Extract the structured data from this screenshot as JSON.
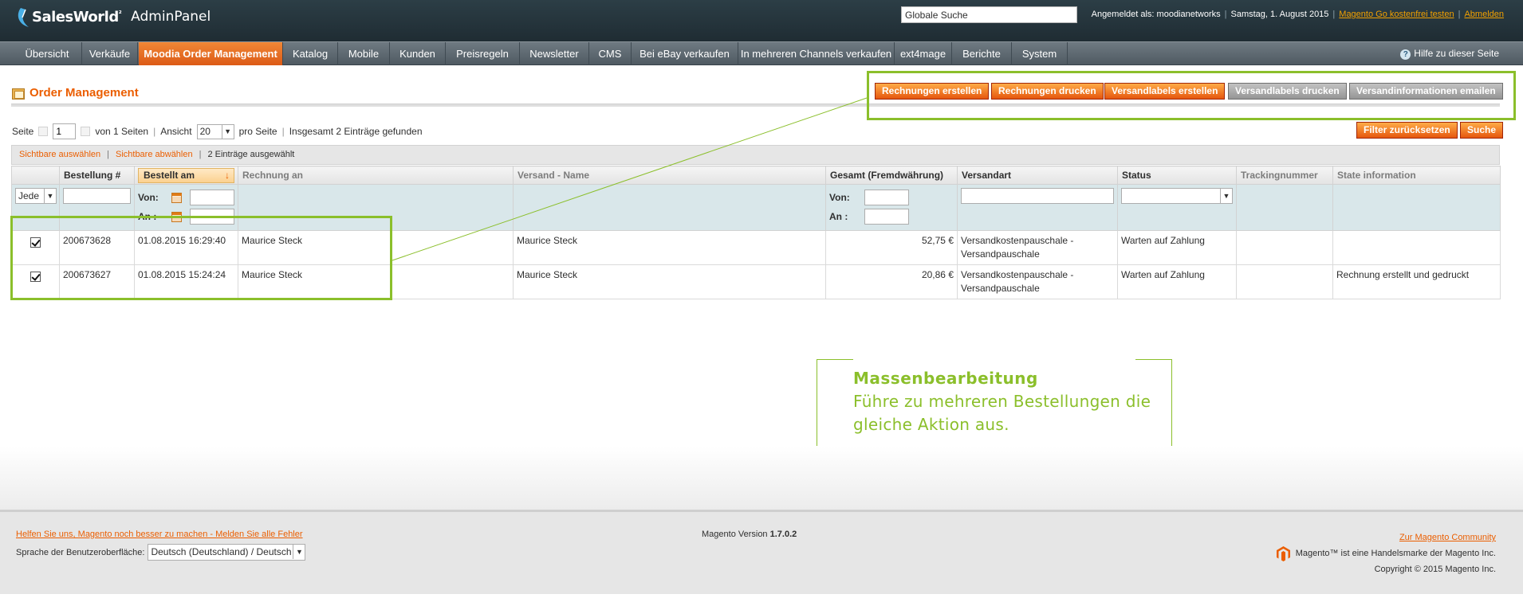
{
  "header": {
    "logo_text": "SalesWorld",
    "logo_sup": "²",
    "logo_sub": "AdminPanel",
    "search_value": "Globale Suche",
    "logged_in": "Angemeldet als: moodianetworks",
    "date": "Samstag, 1. August 2015",
    "try_link": "Magento Go kostenfrei testen",
    "logout_link": "Abmelden"
  },
  "nav": {
    "items": [
      "Übersicht",
      "Verkäufe",
      "Moodia Order Management",
      "Katalog",
      "Mobile",
      "Kunden",
      "Preisregeln",
      "Newsletter",
      "CMS",
      "Bei eBay verkaufen",
      "In mehreren Channels verkaufen",
      "ext4mage",
      "Berichte",
      "System"
    ],
    "help": "Hilfe zu dieser Seite"
  },
  "page": {
    "title": "Order Management"
  },
  "actions": {
    "create_invoices": "Rechnungen erstellen",
    "print_invoices": "Rechnungen drucken",
    "create_labels": "Versandlabels erstellen",
    "print_labels": "Versandlabels drucken",
    "email_shipping": "Versandinformationen emailen",
    "reset_filter": "Filter zurücksetzen",
    "search": "Suche"
  },
  "pager": {
    "page_label": "Seite",
    "page_value": "1",
    "of_pages": "von 1 Seiten",
    "view_label": "Ansicht",
    "per_page": "20",
    "per_page_label": "pro Seite",
    "total": "Insgesamt 2 Einträge gefunden"
  },
  "massaction": {
    "select_visible": "Sichtbare auswählen",
    "unselect_visible": "Sichtbare abwählen",
    "selected_count": "2 Einträge ausgewählt"
  },
  "grid": {
    "columns": [
      "",
      "Bestellung #",
      "Bestellt am",
      "Rechnung an",
      "Versand - Name",
      "Gesamt (Fremdwährung)",
      "Versandart",
      "Status",
      "Trackingnummer",
      "State information"
    ],
    "filter": {
      "any": "Jede",
      "from": "Von:",
      "to": "An :"
    },
    "rows": [
      {
        "order": "200673628",
        "date": "01.08.2015 16:29:40",
        "bill_to": "Maurice Steck",
        "ship_to": "Maurice Steck",
        "total": "52,75 €",
        "shipping": "Versandkostenpauschale - Versandpauschale",
        "status": "Warten auf Zahlung",
        "tracking": "",
        "state": ""
      },
      {
        "order": "200673627",
        "date": "01.08.2015 15:24:24",
        "bill_to": "Maurice Steck",
        "ship_to": "Maurice Steck",
        "total": "20,86 €",
        "shipping": "Versandkostenpauschale - Versandpauschale",
        "status": "Warten auf Zahlung",
        "tracking": "",
        "state": "Rechnung erstellt und gedruckt"
      }
    ]
  },
  "callout": {
    "title": "Massenbearbeitung",
    "line1": "Führe zu mehreren Bestellungen die",
    "line2": "gleiche Aktion aus."
  },
  "footer": {
    "help_link": "Helfen Sie uns, Magento noch besser zu machen - Melden Sie alle Fehler",
    "lang_label": "Sprache der Benutzeroberfläche:",
    "lang_value": "Deutsch (Deutschland) / Deutsch",
    "version_label": "Magento Version",
    "version": "1.7.0.2",
    "community_link": "Zur Magento Community",
    "trademark": "Magento™ ist eine Handelsmarke der Magento Inc.",
    "copyright": "Copyright © 2015 Magento Inc."
  },
  "colors": {
    "accent": "#eb5e00",
    "highlight": "#8bbf2b",
    "header_bg": "#2c3e46"
  }
}
